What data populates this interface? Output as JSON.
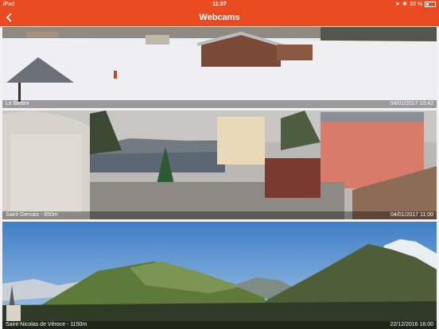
{
  "status": {
    "device": "iPad",
    "time": "11:07",
    "battery": "33 %",
    "battery_level": 0.33
  },
  "nav": {
    "title": "Webcams",
    "back_icon": "chevron-left-icon"
  },
  "colors": {
    "accent": "#e94a1f"
  },
  "webcams": [
    {
      "name": "Le Bettex",
      "timestamp": "04/01/2017 10:42"
    },
    {
      "name": "Saint Gervais - 850m",
      "timestamp": "04/01/2017 11:00"
    },
    {
      "name": "Saint-Nicolas de Véroce - 1150m",
      "timestamp": "22/12/2016 16:00"
    }
  ]
}
